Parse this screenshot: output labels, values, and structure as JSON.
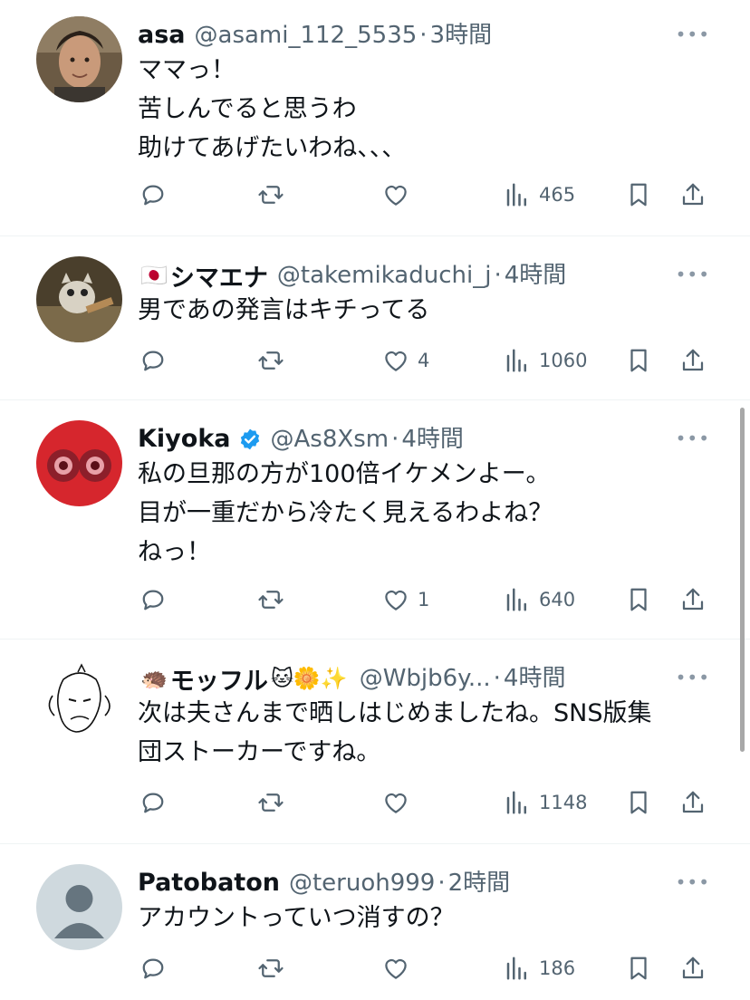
{
  "posts": [
    {
      "name": "asa",
      "name_prefix": "",
      "name_suffix": "",
      "verified": false,
      "handle": "@asami_112_5535",
      "time": "3時間",
      "lines": [
        "ママっ！",
        "苦しんでると思うわ",
        "助けてあげたいわね、、、"
      ],
      "reply_count": "",
      "repost_count": "",
      "like_count": "",
      "view_count": "465",
      "avatar": "photo-man"
    },
    {
      "name": "シマエナ",
      "name_prefix": "🇯🇵",
      "name_suffix": "",
      "verified": false,
      "handle": "@takemikaduchi_j",
      "time": "4時間",
      "lines": [
        "男であの発言はキチってる"
      ],
      "reply_count": "",
      "repost_count": "",
      "like_count": "4",
      "view_count": "1060",
      "avatar": "photo-cat"
    },
    {
      "name": "Kiyoka",
      "name_prefix": "",
      "name_suffix": "",
      "verified": true,
      "handle": "@As8Xsm",
      "time": "4時間",
      "lines": [
        "私の旦那の方が100倍イケメンよー。",
        "目が一重だから冷たく見えるわよね？",
        "ねっ！"
      ],
      "reply_count": "",
      "repost_count": "",
      "like_count": "1",
      "view_count": "640",
      "avatar": "red-earrings"
    },
    {
      "name": "モッフル",
      "name_prefix": "🦔",
      "name_suffix": "🐱🌼✨",
      "verified": false,
      "handle": "@Wbjb6y...",
      "time": "4時間",
      "lines": [
        "次は夫さんまで晒しはじめましたね。SNS版集",
        "団ストーカーですね。"
      ],
      "reply_count": "",
      "repost_count": "",
      "like_count": "",
      "view_count": "1148",
      "avatar": "sketch-face"
    },
    {
      "name": "Patobaton",
      "name_prefix": "",
      "name_suffix": "",
      "verified": false,
      "handle": "@teruoh999",
      "time": "2時間",
      "lines": [
        "アカウントっていつ消すの？"
      ],
      "reply_count": "",
      "repost_count": "",
      "like_count": "",
      "view_count": "186",
      "avatar": "default-person"
    }
  ],
  "ui": {
    "separator": "·",
    "more_label": "•••",
    "colors": {
      "text": "#0f1419",
      "muted": "#536471",
      "verified": "#1d9bf0",
      "divider": "#eff3f4"
    }
  }
}
